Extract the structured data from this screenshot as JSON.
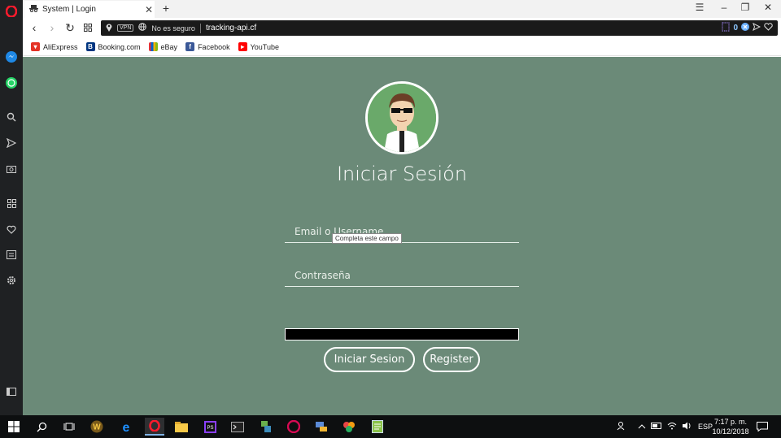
{
  "browser": {
    "tab_title": "System | Login",
    "url_security": "No es seguro",
    "vpn_label": "VPN",
    "url": "tracking-api.cf",
    "adblock_count": "0"
  },
  "bookmarks": [
    {
      "label": "AliExpress",
      "icon": "aliexpress-icon",
      "color": "#e43225"
    },
    {
      "label": "Booking.com",
      "icon": "booking-icon",
      "color": "#003580"
    },
    {
      "label": "eBay",
      "icon": "ebay-icon",
      "color": "#e53238"
    },
    {
      "label": "Facebook",
      "icon": "facebook-icon",
      "color": "#3b5998"
    },
    {
      "label": "YouTube",
      "icon": "youtube-icon",
      "color": "#ff0000"
    }
  ],
  "login": {
    "title": "Iniciar Sesión",
    "email_placeholder": "Email o Username",
    "password_placeholder": "Contraseña",
    "tooltip": "Completa este campo",
    "login_button": "Iniciar Sesion",
    "register_button": "Register"
  },
  "taskbar": {
    "language": "ESP",
    "time": "7:17 p. m.",
    "date": "10/12/2018"
  },
  "colors": {
    "page_bg": "#6b8a78",
    "avatar_bg": "#6aa96a",
    "opera_red": "#ff1b2d"
  }
}
